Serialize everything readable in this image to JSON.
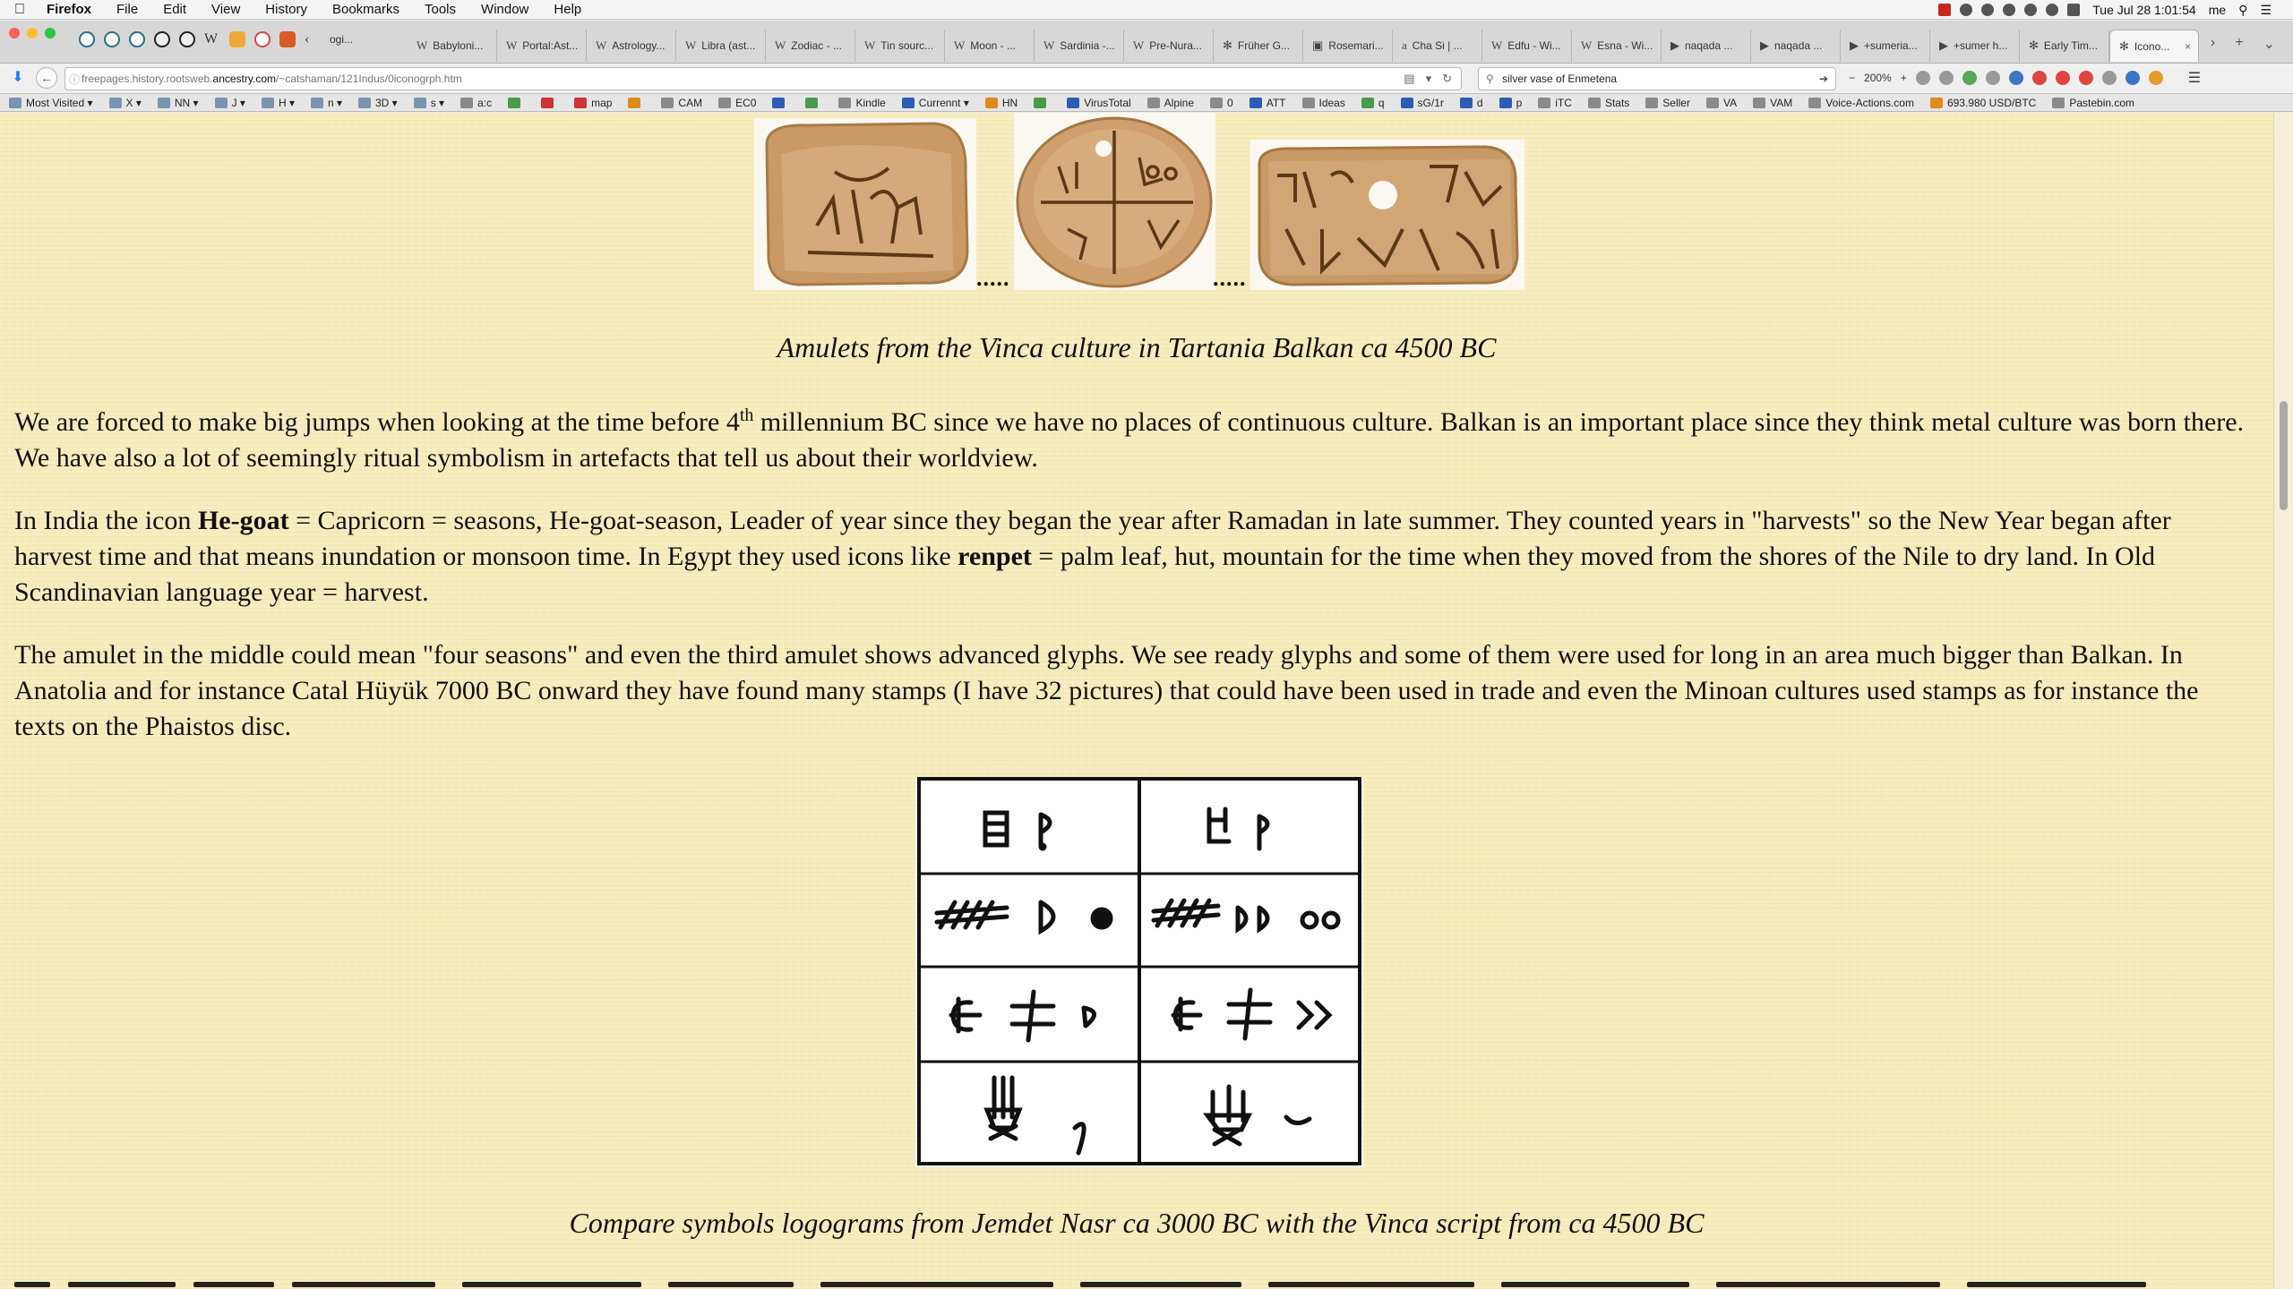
{
  "menubar": {
    "app_name": "Firefox",
    "items": [
      "File",
      "Edit",
      "View",
      "History",
      "Bookmarks",
      "Tools",
      "Window",
      "Help"
    ],
    "clock": "Tue Jul 28  1:01:54",
    "user": "me"
  },
  "tabs": [
    {
      "favicon": "W",
      "label": "Babyloni..."
    },
    {
      "favicon": "W",
      "label": "Portal:Ast..."
    },
    {
      "favicon": "W",
      "label": "Astrology..."
    },
    {
      "favicon": "W",
      "label": "Libra (ast..."
    },
    {
      "favicon": "W",
      "label": "Zodiac - ..."
    },
    {
      "favicon": "W",
      "label": "Tin sourc..."
    },
    {
      "favicon": "W",
      "label": "Moon - ..."
    },
    {
      "favicon": "W",
      "label": "Sardinia -..."
    },
    {
      "favicon": "W",
      "label": "Pre-Nura..."
    },
    {
      "favicon": "✻",
      "label": "Früher G..."
    },
    {
      "favicon": "▣",
      "label": "Rosemari..."
    },
    {
      "favicon": "a",
      "label": "Cha Si | ..."
    },
    {
      "favicon": "W",
      "label": "Edfu - Wi..."
    },
    {
      "favicon": "W",
      "label": "Esna - Wi..."
    },
    {
      "favicon": "▶",
      "label": "naqada ..."
    },
    {
      "favicon": "▶",
      "label": "naqada ..."
    },
    {
      "favicon": "▶",
      "label": "+sumeria..."
    },
    {
      "favicon": "▶",
      "label": "+sumer h..."
    },
    {
      "favicon": "✻",
      "label": "Early Tim..."
    },
    {
      "favicon": "✻",
      "label": "Icono..."
    }
  ],
  "first_tab_partial": "ogi...",
  "navbar": {
    "url_prefix": "freepages.history.rootsweb.",
    "url_domain": "ancestry.com",
    "url_path": "/~catshaman/121Indus/0iconogrph.htm",
    "search_value": "silver vase of Enmetena",
    "zoom": "200%"
  },
  "bookmarks": [
    {
      "label": "Most Visited ▾",
      "icon": "folder"
    },
    {
      "label": "X ▾",
      "icon": "folder"
    },
    {
      "label": "NN ▾",
      "icon": "folder"
    },
    {
      "label": "J ▾",
      "icon": "folder"
    },
    {
      "label": "H ▾",
      "icon": "folder"
    },
    {
      "label": "n ▾",
      "icon": "folder"
    },
    {
      "label": "3D ▾",
      "icon": "folder"
    },
    {
      "label": "s ▾",
      "icon": "folder"
    },
    {
      "label": "a:c",
      "icon": "page"
    },
    {
      "label": "",
      "icon": "green"
    },
    {
      "label": "",
      "icon": "red"
    },
    {
      "label": "map",
      "icon": "red"
    },
    {
      "label": "",
      "icon": "orange"
    },
    {
      "label": "CAM",
      "icon": "page"
    },
    {
      "label": "EC0",
      "icon": "page"
    },
    {
      "label": "",
      "icon": "blue"
    },
    {
      "label": "",
      "icon": "green"
    },
    {
      "label": "Kindle",
      "icon": "page"
    },
    {
      "label": "Currennt ▾",
      "icon": "blue"
    },
    {
      "label": "HN",
      "icon": "orange"
    },
    {
      "label": "",
      "icon": "green"
    },
    {
      "label": "VirusTotal",
      "icon": "blue"
    },
    {
      "label": "Alpine",
      "icon": "page"
    },
    {
      "label": "0",
      "icon": "page"
    },
    {
      "label": "ATT",
      "icon": "blue"
    },
    {
      "label": "Ideas",
      "icon": "page"
    },
    {
      "label": "q",
      "icon": "green"
    },
    {
      "label": "sG/1r",
      "icon": "blue"
    },
    {
      "label": "d",
      "icon": "blue"
    },
    {
      "label": "p",
      "icon": "blue"
    },
    {
      "label": "iTC",
      "icon": "page"
    },
    {
      "label": "Stats",
      "icon": "page"
    },
    {
      "label": "Seller",
      "icon": "page"
    },
    {
      "label": "VA",
      "icon": "page"
    },
    {
      "label": "VAM",
      "icon": "page"
    },
    {
      "label": "Voice-Actions.com",
      "icon": "page"
    },
    {
      "label": "693.980 USD/BTC",
      "icon": "orange"
    },
    {
      "label": "Pastebin.com",
      "icon": "page"
    }
  ],
  "page": {
    "amulet_dots": ".....",
    "caption_amulets": "Amulets from the Vinca culture in Tartania Balkan ca 4500 BC",
    "p1": {
      "before_sup": "We are forced to make big jumps when looking at the time before 4",
      "sup": "th",
      "after_sup": " millennium BC since we have no places of continuous culture. Balkan is an important place since they think metal culture was born there. We have also a lot of seemingly ritual symbolism in artefacts that tell us about their worldview."
    },
    "p2": {
      "t1": "In India the icon ",
      "b1": "He-goat",
      "t2": " = Capricorn = seasons, He-goat-season, Leader of year since they began the year after Ramadan in late summer. They counted years in \"harvests\" so the New Year began after harvest time and that means inundation or monsoon time. In Egypt they used icons like ",
      "b2": "renpet",
      "t3": " = palm leaf, hut, mountain for the time when they moved from the shores of the Nile to dry land. In Old Scandinavian language year = harvest."
    },
    "p3": "The amulet in the middle could mean \"four seasons\" and even the third amulet shows advanced glyphs. We see ready glyphs and some of them were used for long in an area much bigger than Balkan. In Anatolia and for instance Catal Hüyük 7000 BC onward they have found many stamps (I have 32 pictures) that could have been used in trade and even the Minoan cultures used stamps as for instance the texts on the Phaistos disc.",
    "caption_glyphs": "Compare symbols logograms from Jemdet Nasr ca 3000 BC with the Vinca script from ca 4500 BC"
  }
}
